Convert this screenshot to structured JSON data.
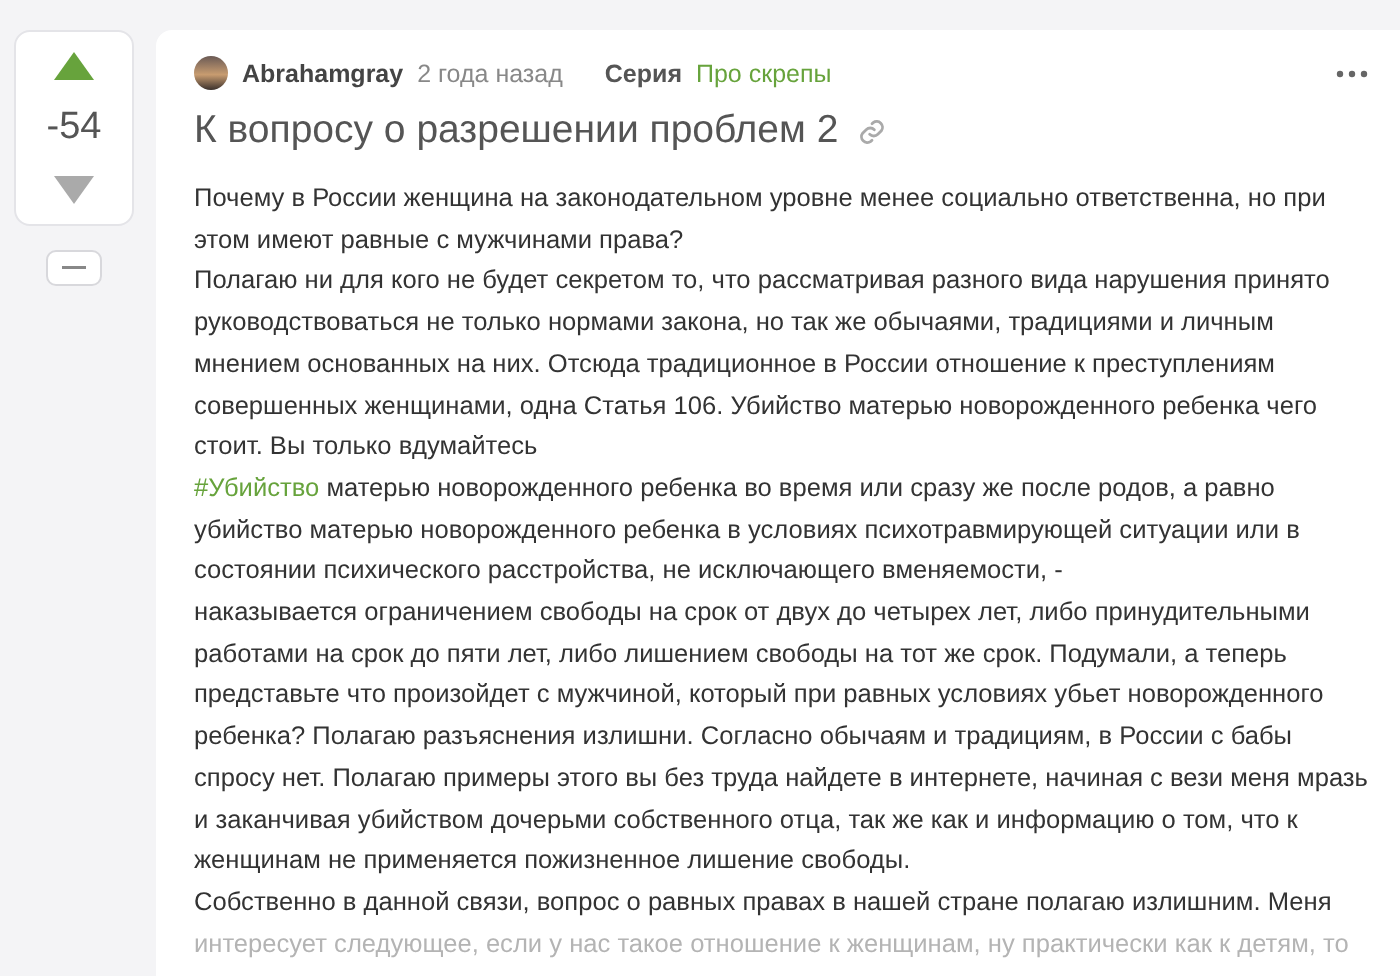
{
  "vote": {
    "rating": "-54"
  },
  "post": {
    "author": "Abrahamgray",
    "time": "2 года назад",
    "series_label": "Серия",
    "series_name": "Про скрепы",
    "title": "К вопросу о разрешении проблем 2",
    "paragraphs": [
      {
        "text": "Почему в России женщина на законодательном уровне менее социально ответственна, но при этом имеют равные с мужчинами права?"
      },
      {
        "text": "Полагаю ни для кого не будет секретом то, что рассматривая разного вида нарушения принято руководствоваться не только нормами закона, но так же обычаями, традициями и личным мнением основанных на них. Отсюда традиционное в России отношение к преступлениям совершенных женщинами, одна Статья 106. Убийство матерью новорожденного ребенка чего стоит. Вы только вдумайтесь"
      },
      {
        "tag": "#Убийство",
        "text": "матерью новорожденного ребенка во время или сразу же после родов, а равно убийство матерью новорожденного ребенка в условиях психотравмирующей ситуации или в состоянии психического расстройства, не исключающего вменяемости, -"
      },
      {
        "text": "наказывается ограничением свободы на срок от двух до четырех лет, либо принудительными работами на срок до пяти лет, либо лишением свободы на тот же срок. Подумали, а теперь представьте что произойдет с мужчиной, который при равных условиях убьет новорожденного ребенка? Полагаю разъяснения излишни. Согласно обычаям и традициям, в России с бабы спросу нет. Полагаю примеры этого вы без труда найдете в интернете, начиная с вези меня мразь и заканчивая убийством дочерьми собственного отца, так же как и информацию о том, что к женщинам не применяется пожизненное лишение свободы."
      },
      {
        "text": "Собственно в данной связи, вопрос о равных правах в нашей стране полагаю излишним. Меня",
        "faded": "интересует следующее, если у нас такое отношение к женщинам, ну практически как к детям, то"
      }
    ]
  }
}
